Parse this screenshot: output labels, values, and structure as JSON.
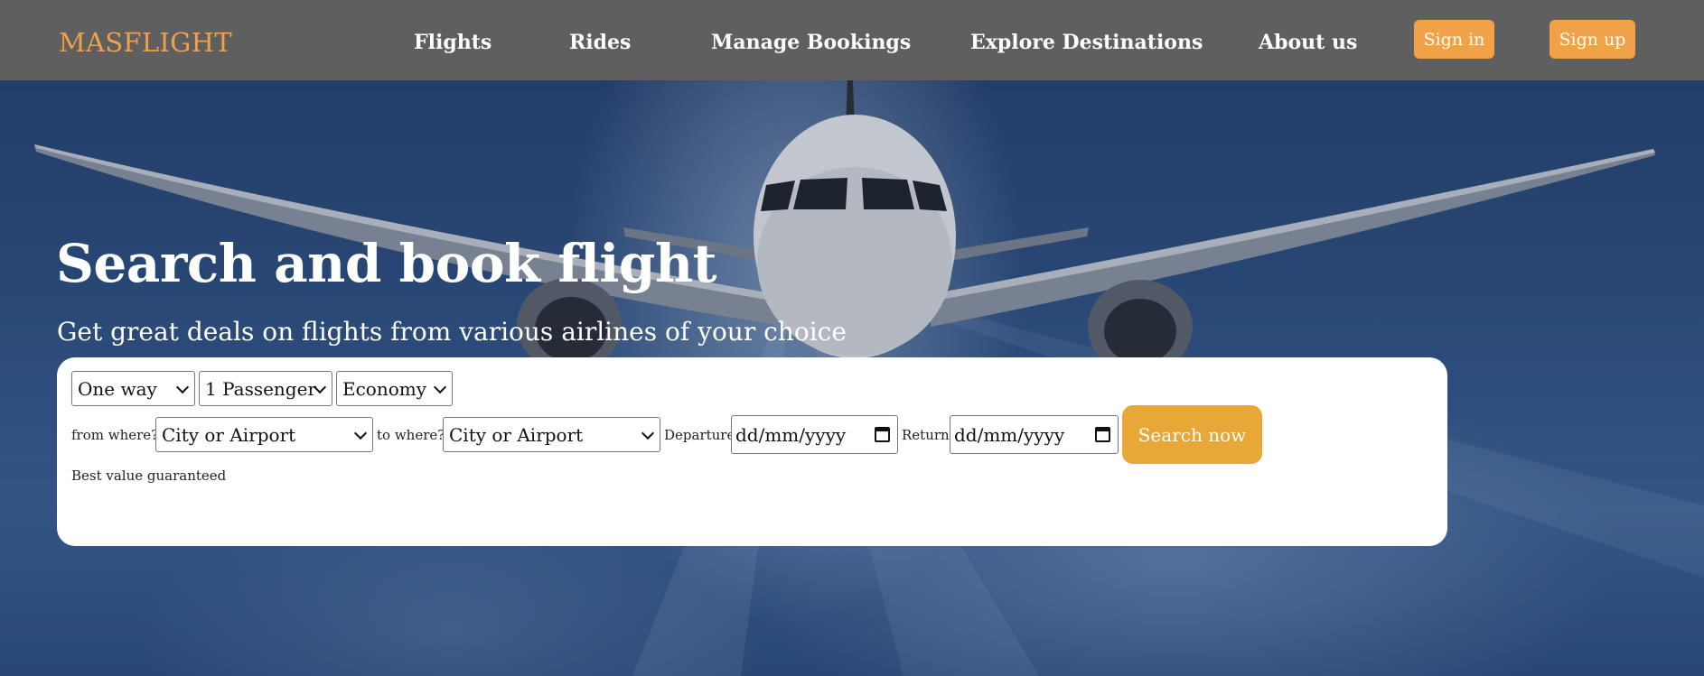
{
  "brand": {
    "name": "MASFLIGHT",
    "color": "#f0a04b"
  },
  "nav": {
    "links": [
      "Flights",
      "Rides",
      "Manage Bookings",
      "Explore Destinations",
      "About us"
    ],
    "sign_in": "Sign in",
    "sign_up": "Sign up"
  },
  "hero": {
    "title": "Search and book flight",
    "subtitle": "Get great deals on flights from various airlines of your choice"
  },
  "search": {
    "trip_type": "One way",
    "passengers": "1 Passenger",
    "cabin": "Economy",
    "from_label": "from where?",
    "from_value": "City or Airport",
    "to_label": "to where?",
    "to_value": "City or Airport",
    "departure_label": "Departure",
    "departure_placeholder": "dd/mm/yyyy",
    "return_label": "Return",
    "return_placeholder": "dd/mm/yyyy",
    "button": "Search now",
    "note": "Best value guaranteed"
  },
  "colors": {
    "navbar": "#5f5f5f",
    "accent": "#f2a246",
    "search_button": "#e8a838"
  }
}
